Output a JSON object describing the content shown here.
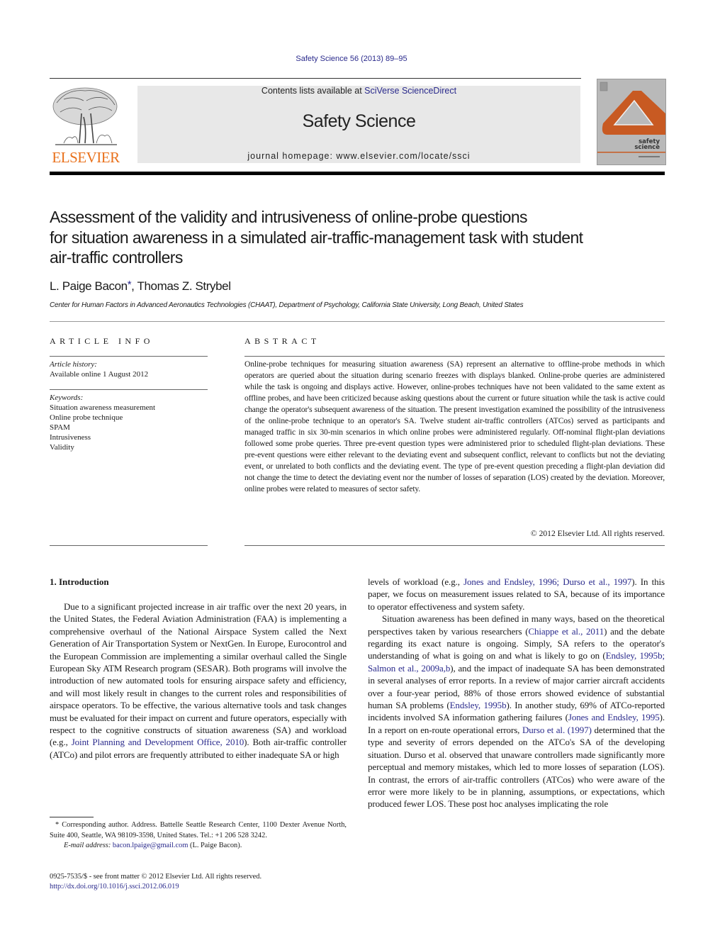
{
  "header": {
    "citation": "Safety Science 56 (2013) 89–95",
    "publisher_logo_text": "ELSEVIER",
    "contents_prefix": "Contents lists available at ",
    "contents_link": "SciVerse ScienceDirect",
    "journal_title": "Safety Science",
    "homepage": "journal homepage: www.elsevier.com/locate/ssci",
    "cover_title_line1": "safety",
    "cover_title_line2": "science",
    "colors": {
      "link": "#2a2a8c",
      "elsevier_orange": "#e9711c",
      "cover_orange": "#c85a22",
      "cover_gray": "#b9b9b9",
      "masthead_gray": "#e8e8e8"
    }
  },
  "article": {
    "title": "Assessment of the validity and intrusiveness of online-probe questions for situation awareness in a simulated air-traffic-management task with student air-traffic controllers",
    "title_lines": [
      "Assessment of the validity and intrusiveness of online-probe questions",
      "for situation awareness in a simulated air-traffic-management task with student",
      "air-traffic controllers"
    ],
    "authors": [
      {
        "name": "L. Paige Bacon",
        "mark": "*"
      },
      {
        "name": "Thomas Z. Strybel",
        "mark": ""
      }
    ],
    "author_separator": ", ",
    "affiliation": "Center for Human Factors in Advanced Aeronautics Technologies (CHAAT), Department of Psychology, California State University, Long Beach, United States"
  },
  "article_info": {
    "heading": "ARTICLE INFO",
    "history_label": "Article history:",
    "history_value": "Available online 1 August 2012",
    "keywords_label": "Keywords:",
    "keywords": [
      "Situation awareness measurement",
      "Online probe technique",
      "SPAM",
      "Intrusiveness",
      "Validity"
    ]
  },
  "abstract": {
    "heading": "ABSTRACT",
    "text": "Online-probe techniques for measuring situation awareness (SA) represent an alternative to offline-probe methods in which operators are queried about the situation during scenario freezes with displays blanked. Online-probe queries are administered while the task is ongoing and displays active. However, online-probes techniques have not been validated to the same extent as offline probes, and have been criticized because asking questions about the current or future situation while the task is active could change the operator's subsequent awareness of the situation. The present investigation examined the possibility of the intrusiveness of the online-probe technique to an operator's SA. Twelve student air-traffic controllers (ATCos) served as participants and managed traffic in six 30-min scenarios in which online probes were administered regularly. Off-nominal flight-plan deviations followed some probe queries. Three pre-event question types were administered prior to scheduled flight-plan deviations. These pre-event questions were either relevant to the deviating event and subsequent conflict, relevant to conflicts but not the deviating event, or unrelated to both conflicts and the deviating event. The type of pre-event question preceding a flight-plan deviation did not change the time to detect the deviating event nor the number of losses of separation (LOS) created by the deviation. Moreover, online probes were related to measures of sector safety.",
    "copyright": "© 2012 Elsevier Ltd. All rights reserved."
  },
  "body": {
    "section_heading": "1. Introduction",
    "left_paragraph": {
      "t1": "Due to a significant projected increase in air traffic over the next 20 years, in the United States, the Federal Aviation Administration (FAA) is implementing a comprehensive overhaul of the National Airspace System called the Next Generation of Air Transportation System or NextGen. In Europe, Eurocontrol and the European Commission are implementing a similar overhaul called the Single European Sky ATM Research program (SESAR). Both programs will involve the introduction of new automated tools for ensuring airspace safety and efficiency, and will most likely result in changes to the current roles and responsibilities of airspace operators. To be effective, the various alternative tools and task changes must be evaluated for their impact on current and future operators, especially with respect to the cognitive constructs of situation awareness (SA) and workload (e.g., ",
      "ref1": "Joint Planning and Development Office, 2010",
      "t2": "). Both air-traffic controller (ATCo) and pilot errors are frequently attributed to either inadequate SA or high"
    },
    "right_paragraph1": {
      "t1": "levels of workload (e.g., ",
      "ref1": "Jones and Endsley, 1996; Durso et al., 1997",
      "t2": "). In this paper, we focus on measurement issues related to SA, because of its importance to operator effectiveness and system safety."
    },
    "right_paragraph2": {
      "t1": "Situation awareness has been defined in many ways, based on the theoretical perspectives taken by various researchers (",
      "ref1": "Chiappe et al., 2011",
      "t2": ") and the debate regarding its exact nature is ongoing. Simply, SA refers to the operator's understanding of what is going on and what is likely to go on (",
      "ref2": "Endsley, 1995b; Salmon et al., 2009a,b",
      "t3": "), and the impact of inadequate SA has been demonstrated in several analyses of error reports. In a review of major carrier aircraft accidents over a four-year period, 88% of those errors showed evidence of substantial human SA problems (",
      "ref3": "Endsley, 1995b",
      "t4": "). In another study, 69% of ATCo-reported incidents involved SA information gathering failures (",
      "ref4": "Jones and Endsley, 1995",
      "t5": "). In a report on en-route operational errors, ",
      "ref5": "Durso et al. (1997)",
      "t6": " determined that the type and severity of errors depended on the ATCo's SA of the developing situation. Durso et al. observed that unaware controllers made significantly more perceptual and memory mistakes, which led to more losses of separation (LOS). In contrast, the errors of air-traffic controllers (ATCos) who were aware of the error were more likely to be in planning, assumptions, or expectations, which produced fewer LOS. These post hoc analyses implicating the role"
    }
  },
  "footnote": {
    "mark": "*",
    "text": "Corresponding author. Address. Battelle Seattle Research Center, 1100 Dexter Avenue North, Suite 400, Seattle, WA 98109-3598, United States. Tel.: +1 206 528 3242.",
    "email_label": "E-mail address:",
    "email": "bacon.lpaige@gmail.com",
    "email_owner": "(L. Paige Bacon)."
  },
  "front_matter": {
    "issn_line": "0925-7535/$ - see front matter © 2012 Elsevier Ltd. All rights reserved.",
    "doi": "http://dx.doi.org/10.1016/j.ssci.2012.06.019"
  }
}
